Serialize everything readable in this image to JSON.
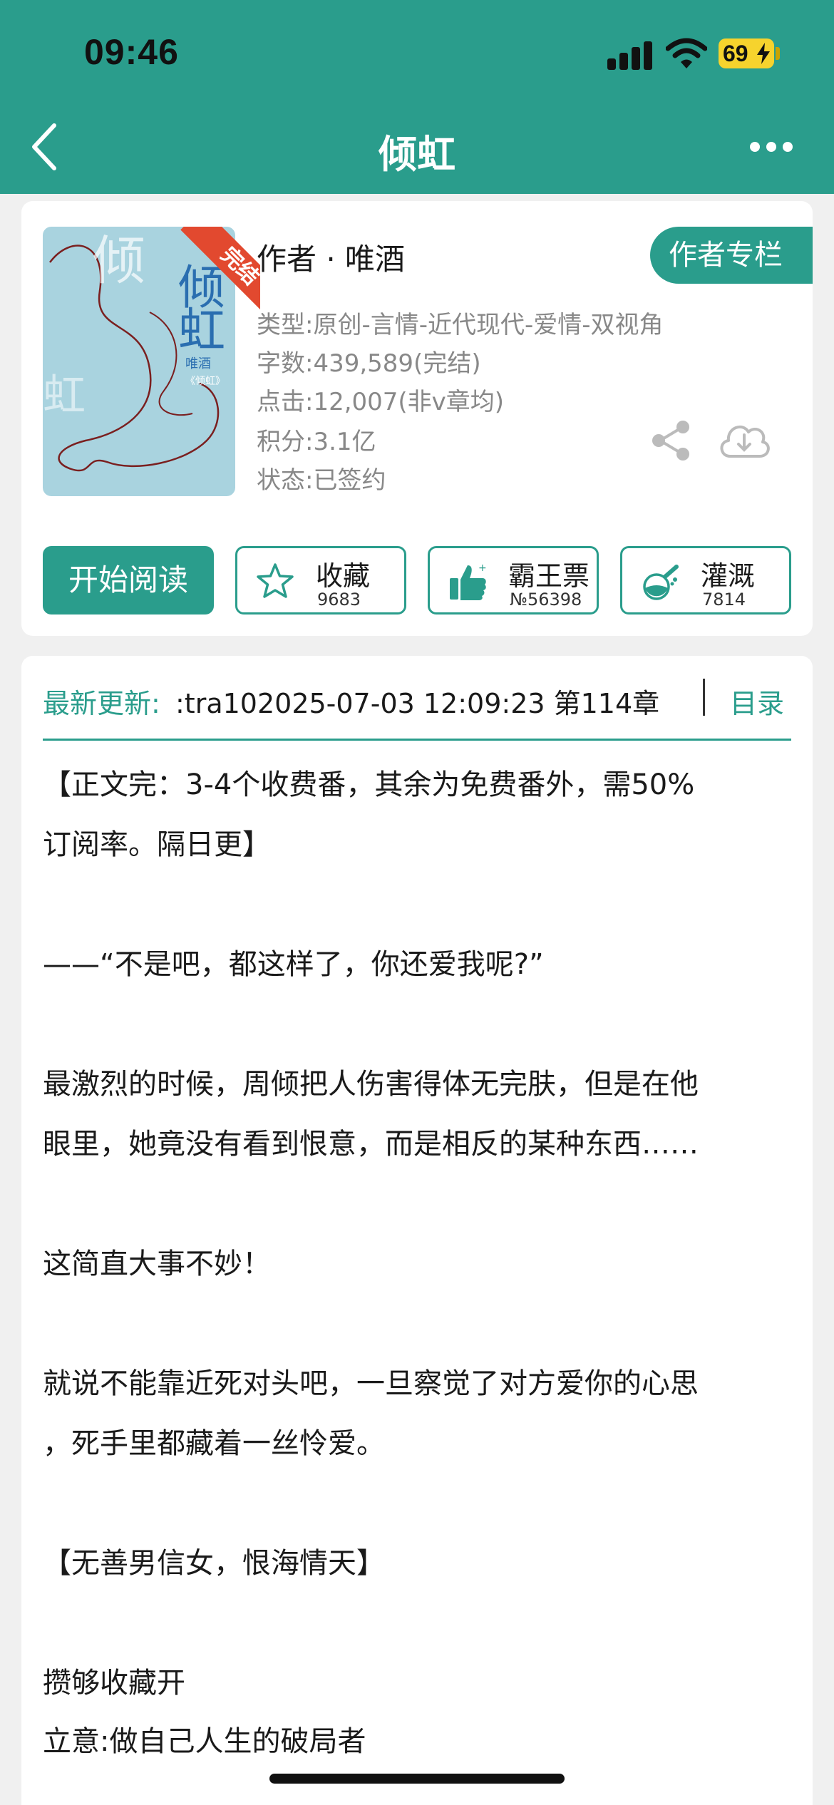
{
  "status_bar": {
    "time": "09:46",
    "battery": "69"
  },
  "nav": {
    "title": "倾虹"
  },
  "cover": {
    "badge": "完结",
    "title_char_1": "倾",
    "title_char_2": "虹",
    "author": "唯酒",
    "subtitle": "《倾虹》"
  },
  "book": {
    "author_line": "作者 · 唯酒",
    "author_column_label": "作者专栏",
    "type": "类型:原创-言情-近代现代-爱情-双视角",
    "word_count": "字数:439,589(完结)",
    "clicks": "点击:12,007(非v章均)",
    "score": "积分:3.1亿",
    "status": "状态:已签约"
  },
  "actions": {
    "read_label": "开始阅读",
    "collect_label": "收藏",
    "collect_count": "9683",
    "bawang_label": "霸王票",
    "bawang_count": "№56398",
    "irrigate_label": "灌溉",
    "irrigate_count": "7814"
  },
  "latest": {
    "label": "最新更新:",
    "text": ":tra102025-07-03 12:09:23   第114章",
    "toc_label": "目录"
  },
  "content": [
    "【正文完：3-4个收费番，其余为免费番外，需50%",
    "订阅率。隔日更】",
    "——“不是吧，都这样了，你还爱我呢?”",
    "最激烈的时候，周倾把人伤害得体无完肤，但是在他",
    "眼里，她竟没有看到恨意，而是相反的某种东西……",
    "这简直大事不妙！",
    "就说不能靠近死对头吧，一旦察觉了对方爱你的心思",
    "，死手里都藏着一丝怜爱。",
    "【无善男信女，恨海情天】",
    "攒够收藏开",
    "立意:做自己人生的破局者"
  ],
  "colors": {
    "brand_teal": "#2a9d8c",
    "badge_red": "#e2492f",
    "battery_yellow": "#f6d32d"
  },
  "icons": [
    "back-chevron-icon",
    "more-dots-icon",
    "share-icon",
    "download-cloud-icon",
    "star-icon",
    "thumbs-up-icon",
    "watering-flask-icon"
  ]
}
